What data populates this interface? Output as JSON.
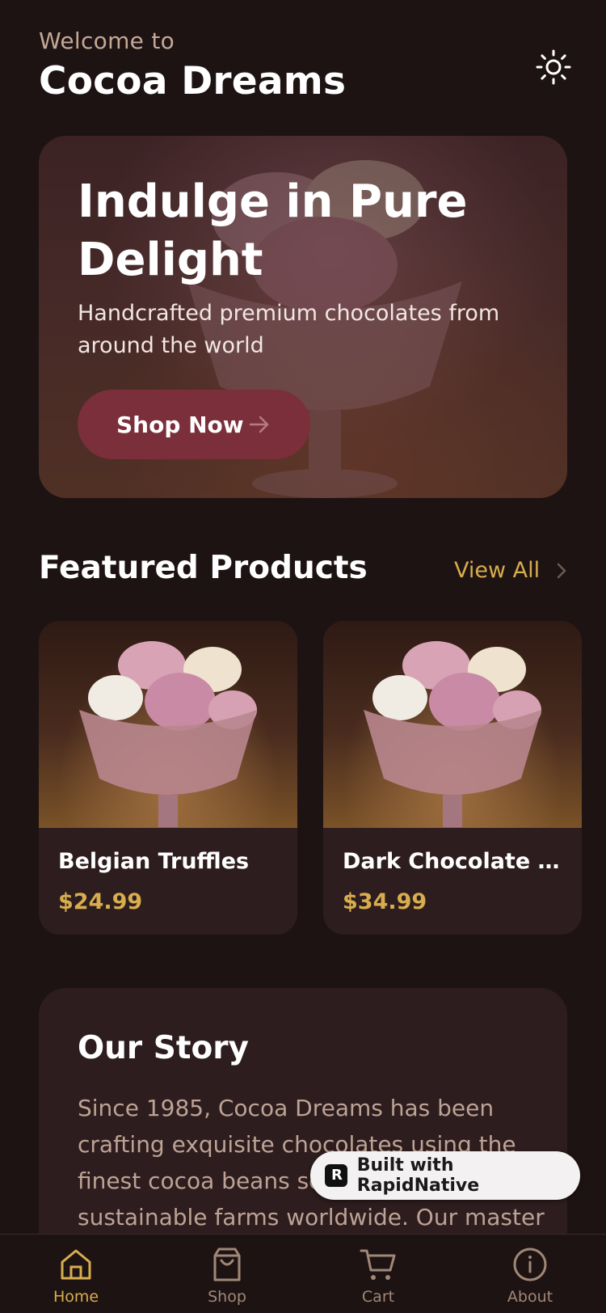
{
  "header": {
    "welcome": "Welcome to",
    "brand": "Cocoa Dreams",
    "theme_icon": "sun-icon"
  },
  "hero": {
    "title": "Indulge in Pure Delight",
    "subtitle": "Handcrafted premium chocolates from around the world",
    "cta_label": "Shop Now",
    "cta_icon": "arrow-right-icon"
  },
  "featured": {
    "title": "Featured Products",
    "view_all_label": "View All",
    "products": [
      {
        "name": "Belgian Truffles",
        "price": "$24.99"
      },
      {
        "name": "Dark Chocolate B...",
        "price": "$34.99"
      }
    ]
  },
  "story": {
    "title": "Our Story",
    "body": "Since 1985, Cocoa Dreams has been crafting exquisite chocolates using the finest cocoa beans sourced from sustainable farms worldwide. Our master"
  },
  "badge": {
    "label": "Built with RapidNative"
  },
  "tabs": [
    {
      "label": "Home",
      "icon": "home-icon",
      "active": true
    },
    {
      "label": "Shop",
      "icon": "shopping-bag-icon",
      "active": false
    },
    {
      "label": "Cart",
      "icon": "cart-icon",
      "active": false
    },
    {
      "label": "About",
      "icon": "info-icon",
      "active": false
    }
  ],
  "colors": {
    "background": "#1e1313",
    "card": "#2d1d1e",
    "accent": "#d7ad4e",
    "button": "#7a2f3a",
    "muted": "#bda395"
  }
}
